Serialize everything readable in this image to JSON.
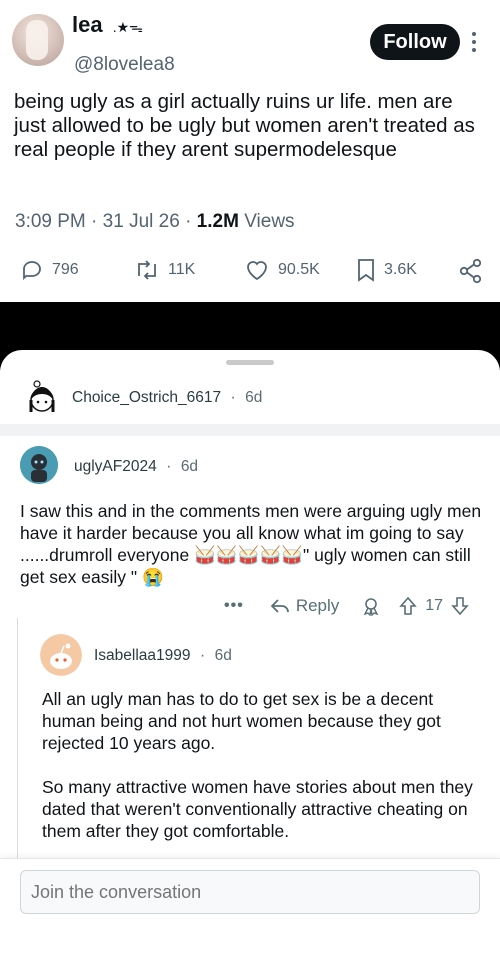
{
  "tweet": {
    "display_name": "lea",
    "name_decoration": ".★ᯓ",
    "handle": "@8lovelea8",
    "follow_label": "Follow",
    "text": "being ugly as a girl actually ruins ur life. men are just allowed to be ugly but women aren't treated as real people if they arent supermodelesque",
    "time": "3:09 PM",
    "dot": "·",
    "date": "31 Jul 26",
    "views_count": "1.2M",
    "views_label": "Views",
    "replies": "796",
    "reposts": "11K",
    "likes": "90.5K",
    "bookmarks": "3.6K"
  },
  "thread": {
    "parent": {
      "username": "Choice_Ostrich_6617",
      "age": "6d"
    },
    "comment1": {
      "username": "uglyAF2024",
      "age": "6d",
      "text": "I saw this and in the comments men were arguing ugly men have it harder because you all know what im going to say ......drumroll everyone 🥁🥁🥁🥁🥁\" ugly women can still get sex easily \" 😭",
      "reply_label": "Reply",
      "votes": "17"
    },
    "comment2": {
      "username": "Isabellaa1999",
      "age": "6d",
      "paragraph1": "All an ugly man has to do to get sex is be a decent human being and not hurt women because they got rejected 10 years ago.",
      "paragraph2": "So many attractive women have stories about men they dated that weren't conventionally attractive cheating on them after they got comfortable."
    },
    "dot": "·"
  },
  "composer": {
    "placeholder": "Join the conversation"
  },
  "colors": {
    "text": "#0f1419",
    "muted": "#536471",
    "follow_bg": "#0f1419",
    "band": "#000000"
  }
}
